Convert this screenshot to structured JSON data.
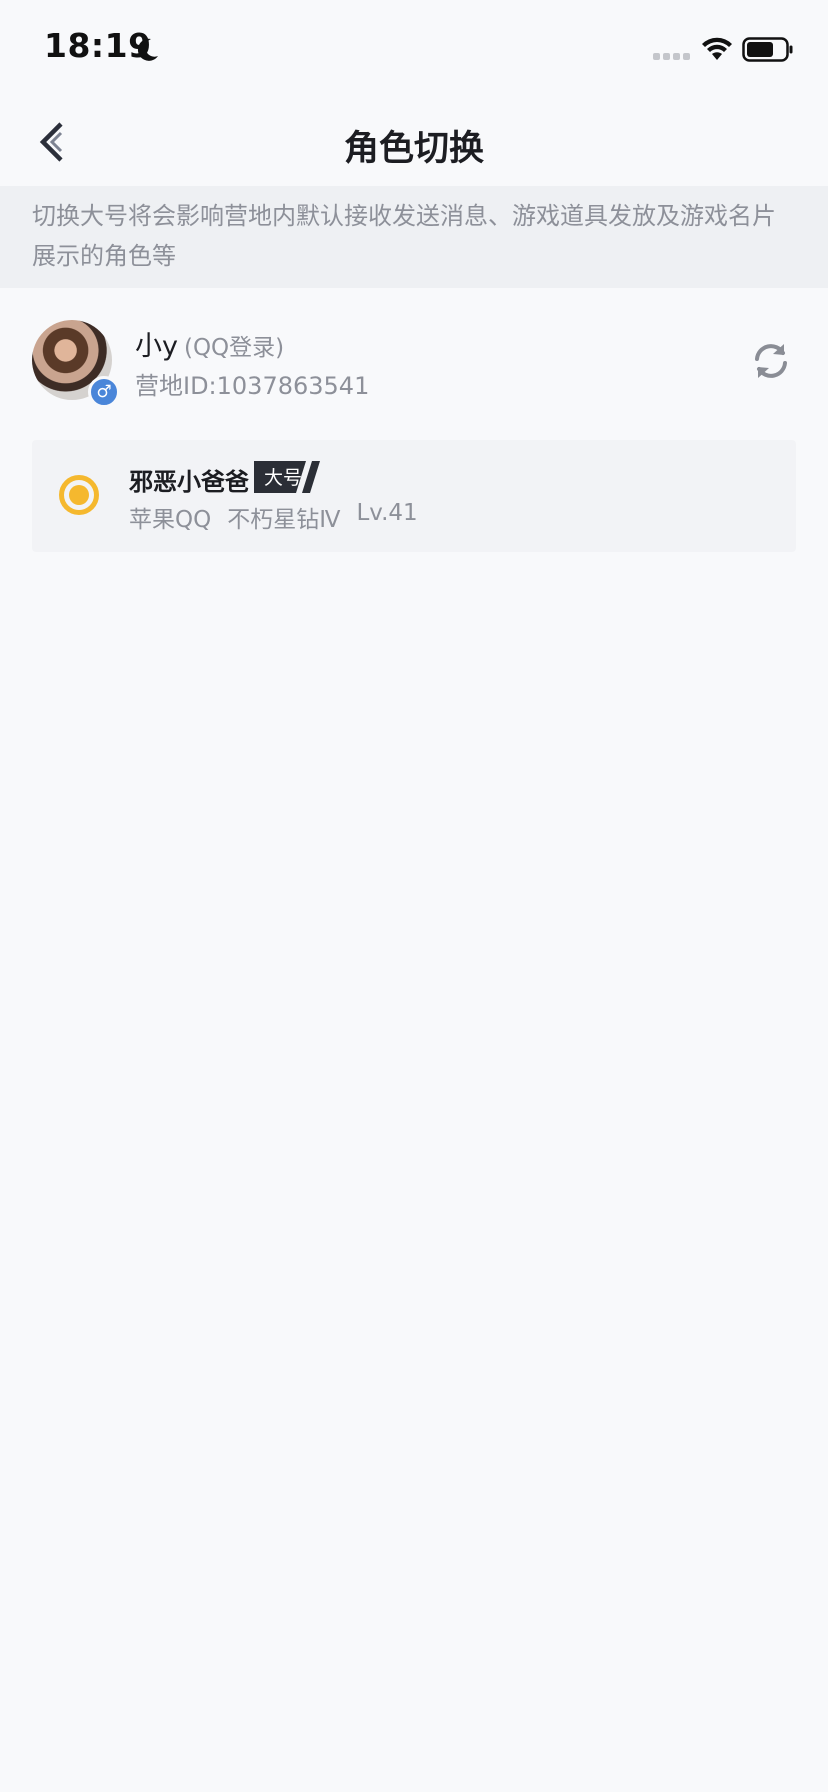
{
  "status_bar": {
    "time": "18:19"
  },
  "nav": {
    "title": "角色切换"
  },
  "notice": {
    "text": "切换大号将会影响营地内默认接收发送消息、游戏道具发放及游戏名片展示的角色等"
  },
  "profile": {
    "name": "小y",
    "login_type": "(QQ登录)",
    "camp_id": "营地ID:1037863541",
    "gender_symbol": "♂"
  },
  "role": {
    "name": "邪恶小爸爸",
    "tag": "大号",
    "platform": "苹果QQ",
    "rank": "不朽星钻Ⅳ",
    "level": "Lv.41",
    "selected": true
  },
  "colors": {
    "accent_yellow": "#f5b82e",
    "background": "#f8f9fb",
    "notice_background": "#eef0f3",
    "secondary_text": "#8d9099",
    "tag_dark": "#2b2e36",
    "gender_blue": "#4a86d9"
  },
  "icons": {
    "status_moon": "moon-icon",
    "status_signal": "signal-icon",
    "status_wifi": "wifi-icon",
    "status_battery": "battery-icon",
    "back": "chevron-left-icon",
    "refresh": "refresh-icon",
    "gender": "male-icon",
    "radio": "radio-selected-icon"
  }
}
